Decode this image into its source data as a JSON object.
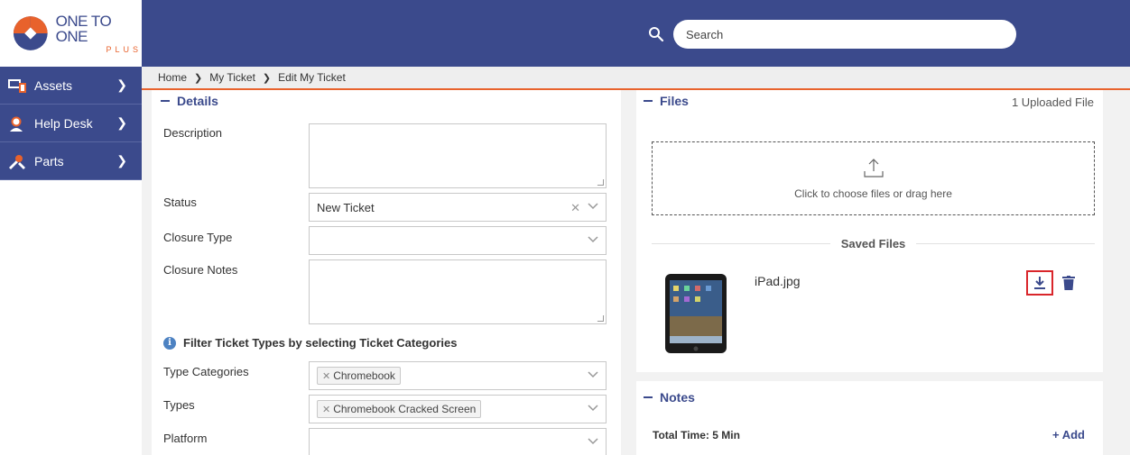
{
  "brand": {
    "name": "ONE TO ONE",
    "sub": "PLUS"
  },
  "search": {
    "placeholder": "Search"
  },
  "sidebar": {
    "items": [
      {
        "label": "Assets",
        "icon": "assets-icon"
      },
      {
        "label": "Help Desk",
        "icon": "help-desk-icon"
      },
      {
        "label": "Parts",
        "icon": "parts-icon"
      }
    ]
  },
  "breadcrumb": {
    "items": [
      "Home",
      "My Ticket",
      "Edit My Ticket"
    ]
  },
  "details": {
    "title": "Details",
    "labels": {
      "description": "Description",
      "status": "Status",
      "closure_type": "Closure Type",
      "closure_notes": "Closure Notes",
      "type_categories": "Type Categories",
      "types": "Types",
      "platform": "Platform"
    },
    "status_value": "New Ticket",
    "filter_note": "Filter Ticket Types by selecting Ticket Categories",
    "type_categories_chip": "Chromebook",
    "types_chip": "Chromebook Cracked Screen"
  },
  "files": {
    "title": "Files",
    "count_label": "1 Uploaded File",
    "dropzone_text": "Click to choose files or drag here",
    "saved_title": "Saved Files",
    "saved": [
      {
        "name": "iPad.jpg"
      }
    ]
  },
  "notes": {
    "title": "Notes",
    "total_time": "Total Time: 5 Min",
    "add_label": "+ Add"
  },
  "colors": {
    "primary": "#3b4a8c",
    "accent": "#e8622c",
    "highlight": "#d9262b"
  }
}
